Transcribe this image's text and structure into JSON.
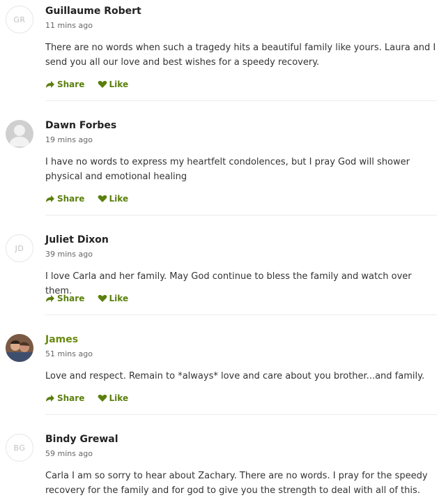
{
  "accent_color": "#5b7f0d",
  "comments": [
    {
      "initials": "GR",
      "name": "Guillaume Robert",
      "time": "11 mins ago",
      "text": "There are no words when such a tragedy hits a beautiful family like yours. Laura and I send you all our love and best wishes for a speedy recovery.",
      "share_label": "Share",
      "like_label": "Like"
    },
    {
      "initials": "",
      "name": "Dawn Forbes",
      "time": "19 mins ago",
      "text": "I have no words to express my heartfelt condolences, but I pray God will shower physical and emotional healing",
      "share_label": "Share",
      "like_label": "Like"
    },
    {
      "initials": "JD",
      "name": "Juliet Dixon",
      "time": "39 mins ago",
      "text": "I love Carla and her family. May God continue to bless the family and watch over them.",
      "share_label": "Share",
      "like_label": "Like"
    },
    {
      "initials": "",
      "name": "James",
      "time": "51 mins ago",
      "text": "Love and respect. Remain to *always* love and care about you brother...and family.",
      "share_label": "Share",
      "like_label": "Like"
    },
    {
      "initials": "BG",
      "name": "Bindy Grewal",
      "time": "59 mins ago",
      "text": "Carla I am so sorry to hear about Zachary. There are no words. I pray for the speedy recovery for the family and for god to give you the strength to deal with all of this.",
      "share_label": "Share",
      "like_label": "Like"
    }
  ]
}
